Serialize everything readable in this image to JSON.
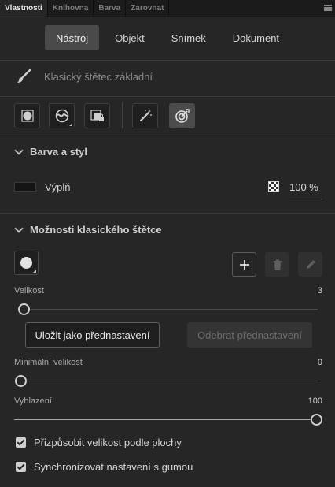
{
  "panel_tabs": [
    "Vlastnosti",
    "Knihovna",
    "Barva",
    "Zarovnat"
  ],
  "main_tabs": [
    "Nástroj",
    "Objekt",
    "Snímek",
    "Dokument"
  ],
  "active_main_tab": "Nástroj",
  "tool": {
    "icon": "brush-icon",
    "name": "Klasický štětec základní"
  },
  "toolbar_icons": [
    "object-drawing-mode-icon",
    "smoothing-mode-icon",
    "lock-fill-icon",
    "magic-wand-icon",
    "pressure-target-icon"
  ],
  "color_section": {
    "title": "Barva a styl",
    "fill_label": "Výplň",
    "fill_color": "#141414",
    "opacity": "100 %"
  },
  "brush_section": {
    "title": "Možnosti klasického štětce",
    "shape_icon": "circle-brush-shape-icon",
    "add_icon": "plus-icon",
    "delete_icon": "trash-icon",
    "edit_icon": "pencil-icon",
    "size": {
      "label": "Velikost",
      "value": "3",
      "fraction": 0.02
    },
    "save_preset": "Uložit jako přednastavení",
    "remove_preset": "Odebrat přednastavení",
    "min_size": {
      "label": "Minimální velikost",
      "value": "0",
      "fraction": 0.0
    },
    "smoothing": {
      "label": "Vyhlazení",
      "value": "100",
      "fraction": 1.0
    },
    "checkbox_fit": {
      "label": "Přizpůsobit velikost podle plochy",
      "checked": true
    },
    "checkbox_sync": {
      "label": "Synchronizovat nastavení s gumou",
      "checked": true
    }
  },
  "colors": {
    "panel_bg": "#262626",
    "header_bg": "#1b1b1b",
    "active_tab_bg": "#4a4a4a"
  }
}
